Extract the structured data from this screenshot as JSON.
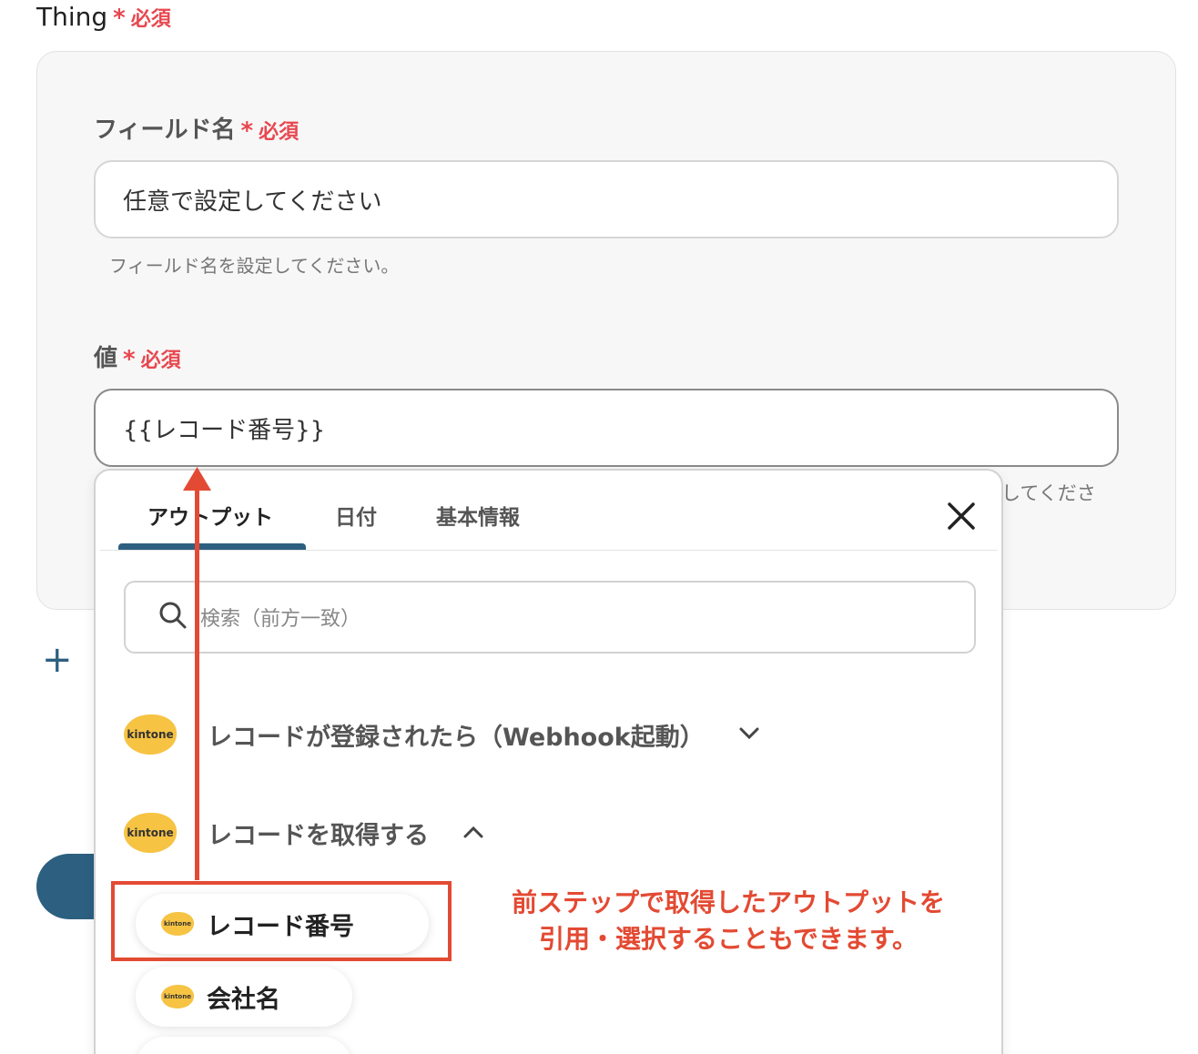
{
  "thing": {
    "label": "Thing",
    "required_star": "*",
    "required_text": "必須"
  },
  "field_name": {
    "label": "フィールド名",
    "required_star": "*",
    "required_text": "必須",
    "value": "任意で設定してください",
    "helper": "フィールド名を設定してください。"
  },
  "value_field": {
    "label": "値",
    "required_star": "*",
    "required_text": "必須",
    "value": "{{レコード番号}}",
    "helper_partial": "してくださ"
  },
  "popup": {
    "tabs": [
      {
        "label": "アウトプット",
        "active": true
      },
      {
        "label": "日付",
        "active": false
      },
      {
        "label": "基本情報",
        "active": false
      }
    ],
    "close_icon": "close-icon",
    "search_placeholder": "検索（前方一致）",
    "groups": [
      {
        "title": "レコードが登録されたら（Webhook起動）",
        "expanded": false,
        "icon": "chevron-down-icon"
      },
      {
        "title": "レコードを取得する",
        "expanded": true,
        "icon": "chevron-up-icon"
      }
    ],
    "logo_text": "kintone",
    "items": [
      {
        "label": "レコード番号"
      },
      {
        "label": "会社名"
      }
    ]
  },
  "annotation": {
    "line1": "前ステップで取得したアウトプットを",
    "line2": "引用・選択することもできます。"
  },
  "colors": {
    "accent": "#2d5f80",
    "required": "#e8474f",
    "annotation": "#e34a33",
    "kintone": "#f6c343"
  }
}
